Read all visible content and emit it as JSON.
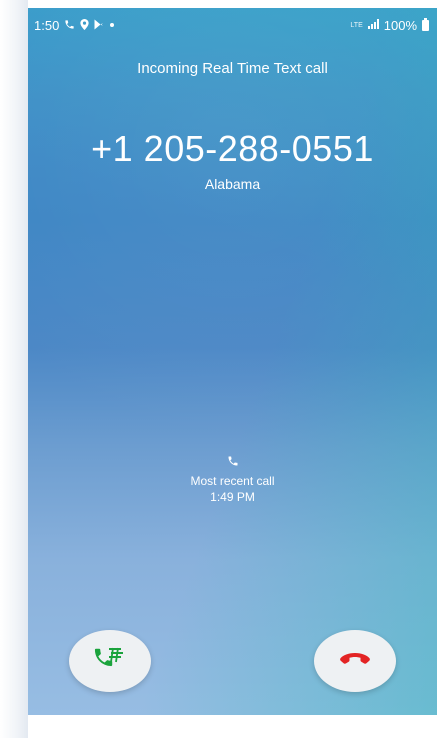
{
  "status_bar": {
    "time": "1:50",
    "left_icons": [
      "phone-icon",
      "location-pin-icon",
      "play-store-icon",
      "dot-icon"
    ],
    "network_label": "LTE",
    "battery_text": "100%"
  },
  "call": {
    "type_label": "Incoming Real Time Text call",
    "number": "+1 205-288-0551",
    "location": "Alabama"
  },
  "recent": {
    "icon": "phone-icon",
    "label": "Most recent call",
    "time": "1:49 PM"
  },
  "actions": {
    "accept_icon": "rtt-accept-icon",
    "decline_icon": "decline-call-icon",
    "accept_color": "#1aa33c",
    "decline_color": "#e32424"
  }
}
